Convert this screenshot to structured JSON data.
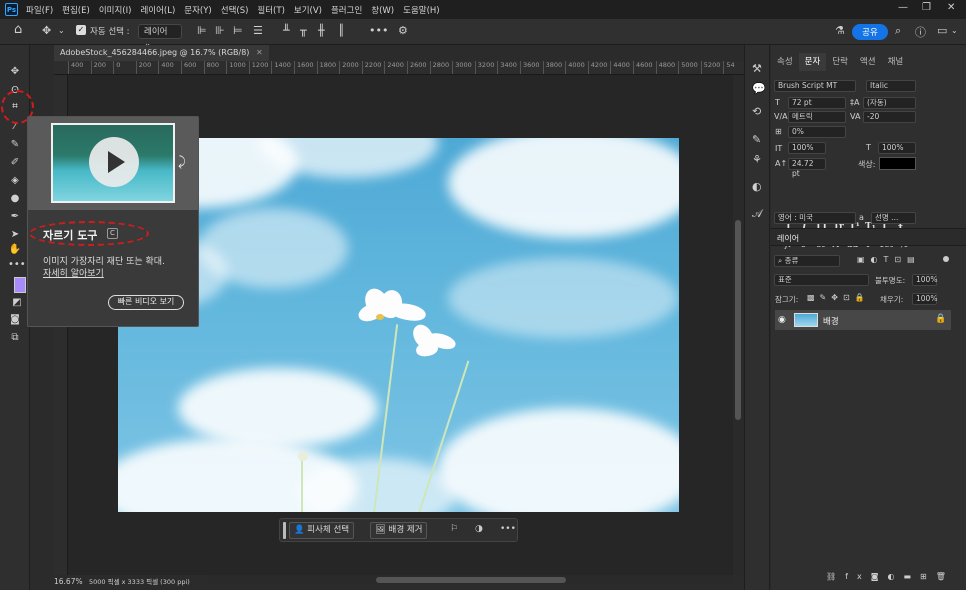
{
  "menubar": {
    "logo": "Ps",
    "items": [
      "파일(F)",
      "편집(E)",
      "이미지(I)",
      "레이어(L)",
      "문자(Y)",
      "선택(S)",
      "필터(T)",
      "보기(V)",
      "플러그인",
      "창(W)",
      "도움말(H)"
    ]
  },
  "options": {
    "auto_select_label": "자동 선택 :",
    "auto_select_value": "레이어",
    "more": "•••",
    "share": "공유"
  },
  "document": {
    "tab_label": "AdobeStock_456284466.jpeg @ 16.7% (RGB/8)",
    "zoom": "16.67%",
    "info": "5000 픽셀 x 3333 픽셀 (300 ppi)"
  },
  "ruler": {
    "ticks": [
      "400",
      "200",
      "0",
      "200",
      "400",
      "600",
      "800",
      "1000",
      "1200",
      "1400",
      "1600",
      "1800",
      "2000",
      "2200",
      "2400",
      "2600",
      "2800",
      "3000",
      "3200",
      "3400",
      "3600",
      "3800",
      "4000",
      "4200",
      "4400",
      "4600",
      "4800",
      "5000",
      "5200",
      "54"
    ]
  },
  "context_bar": {
    "select_subject": "피사체 선택",
    "remove_bg": "배경 제거",
    "more": "•••"
  },
  "tooltip": {
    "title": "자르기 도구",
    "shortcut": "C",
    "description": "이미지 가장자리 재단 또는 확대.",
    "learn_more": "자세히 알아보기",
    "video_button": "빠른 비디오 보기"
  },
  "character_panel": {
    "tabs": [
      "속성",
      "문자",
      "단락",
      "액션",
      "채널"
    ],
    "font_family": "Brush Script MT",
    "font_style": "Italic",
    "font_size": "72 pt",
    "leading": "(자동)",
    "kerning": "메트릭",
    "tracking": "-20",
    "tsume": "0%",
    "vertical_scale": "100%",
    "horizontal_scale": "100%",
    "baseline": "24.72 pt",
    "color_label": "색상:",
    "language": "영어 : 미국",
    "aa_label": "a",
    "aa_value": "선명 ...",
    "format_buttons": [
      "T",
      "T",
      "TT",
      "Tr",
      "T¹",
      "T₁",
      "T",
      "Ŧ"
    ],
    "ligatures": [
      "fi",
      "ơ",
      "st",
      "A",
      "ad",
      "T",
      "1st",
      "½"
    ]
  },
  "layers_panel": {
    "title": "레이어",
    "filter": "종류",
    "blend_mode": "표준",
    "opacity_label": "불투명도:",
    "opacity_value": "100%",
    "lock_label": "잠그기:",
    "fill_label": "채우기:",
    "fill_value": "100%",
    "layer_name": "배경",
    "footer_icons": [
      "link-icon",
      "fx",
      "mask-icon",
      "adjustment-icon",
      "folder-icon",
      "new-layer-icon",
      "trash-icon"
    ]
  },
  "colors": {
    "accent": "#1473e6",
    "annotation": "#d21c1c",
    "swatch_fg": "#a78bfa"
  }
}
